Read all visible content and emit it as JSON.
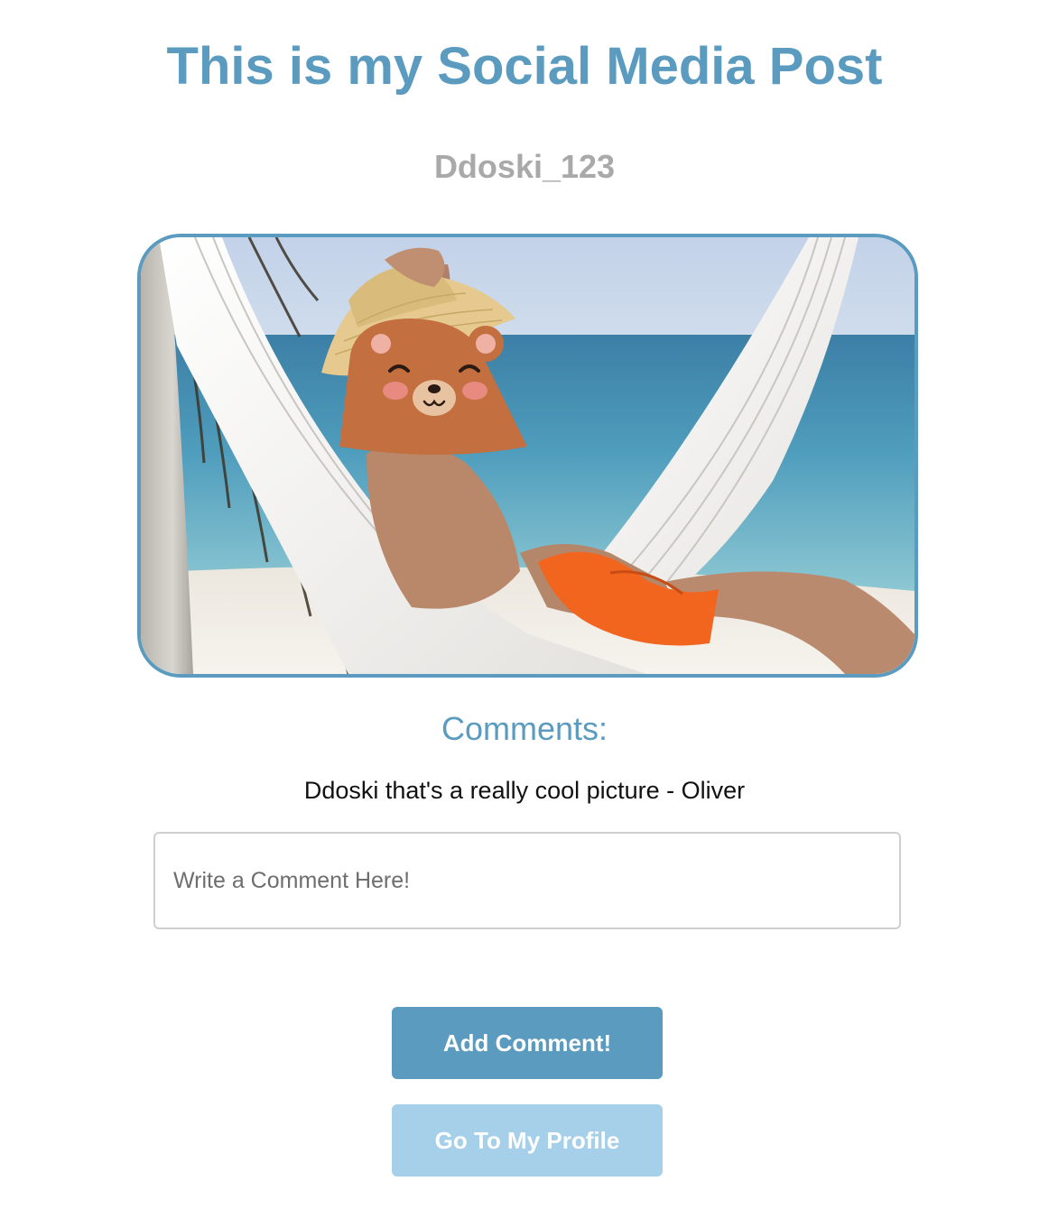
{
  "page": {
    "title": "This is my Social Media Post",
    "username": "Ddoski_123"
  },
  "post": {
    "image_icon": "beach-hammock-photo",
    "colors": {
      "frame_border": "#5a9bbf",
      "title": "#5a9bbf",
      "username": "#a9a9a9"
    }
  },
  "comments": {
    "heading": "Comments:",
    "items": [
      {
        "text": "Ddoski that's a really cool picture - Oliver"
      }
    ]
  },
  "comment_form": {
    "value": "",
    "placeholder": "Write a Comment Here!",
    "add_button_label": "Add Comment!",
    "profile_button_label": "Go To My Profile"
  },
  "colors": {
    "accent": "#5a9bbf",
    "accent_light": "#a6d0ea",
    "input_border": "#cfcfcf"
  }
}
